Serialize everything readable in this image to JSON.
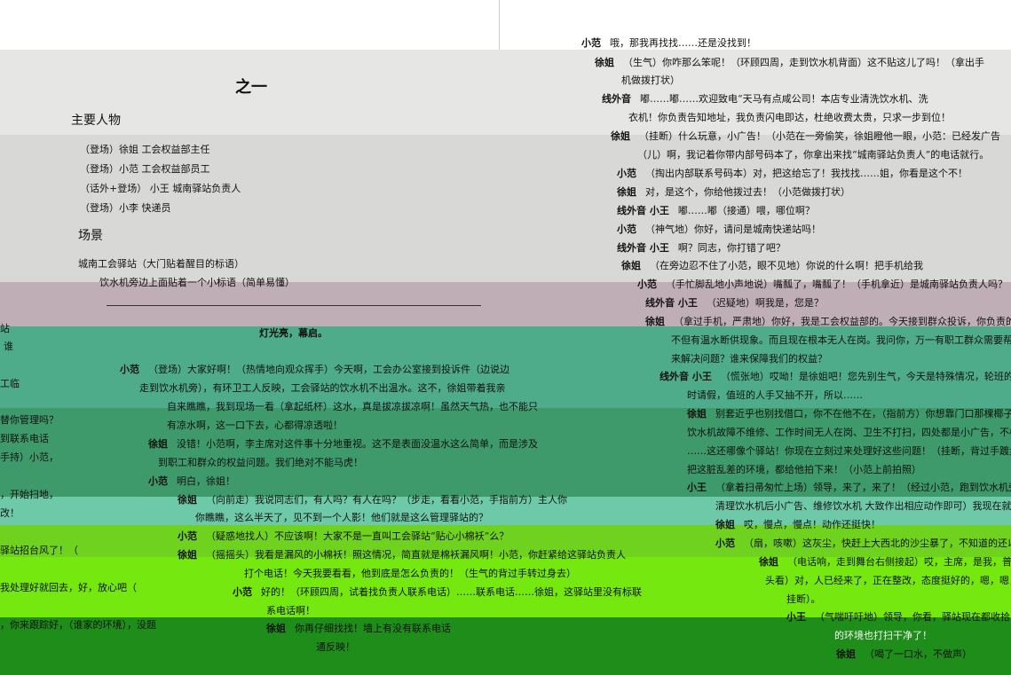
{
  "left": {
    "title": "之一",
    "characters_heading": "主要人物",
    "characters": [
      "（登场）徐姐 工会权益部主任",
      "（登场）小范 工会权益部员工",
      "（话外+登场） 小王 城南驿站负责人",
      "（登场）小李 快递员"
    ],
    "scene_heading": "场景",
    "scene_lines": [
      "城南工会驿站（大门贴着醒目的标语）",
      "饮水机旁边上面贴着一个小标语（简单易懂）"
    ],
    "stage_curtain": "灯光亮，幕启。",
    "dialogue": [
      {
        "speaker": "小范",
        "text": "（登场）大家好啊！（热情地向观众挥手）今天啊，工会办公室接到投诉件（边说边"
      },
      {
        "speaker": "",
        "text": "走到饮水机旁），有环卫工人反映，工会驿站的饮水机不出温水。这不，徐姐带着我亲"
      },
      {
        "speaker": "",
        "text": "自来瞧瞧，我到现场一看（拿起纸杯）这水，真是拔凉拔凉啊！虽然天气热，也不能只"
      },
      {
        "speaker": "",
        "text": "有凉水啊，这一口下去，心都得凉透啦！"
      },
      {
        "speaker": "徐姐",
        "text": "没错！小范啊，李主席对这件事十分地重视。这不是表面没温水这么简单，而是涉及"
      },
      {
        "speaker": "",
        "text": "到职工和群众的权益问题。我们绝对不能马虎！"
      },
      {
        "speaker": "小范",
        "text": "明白，徐姐！"
      },
      {
        "speaker": "徐姐",
        "text": "（向前走）我说同志们，有人吗？有人在吗？（步走，看看小范，手指前方）主人你"
      },
      {
        "speaker": "",
        "text": "你瞧瞧，这么半天了，见不到一个人影！他们就是这么管理驿站的？"
      },
      {
        "speaker": "小范",
        "text": "（疑惑地找人）不应该啊！大家不是一直叫工会驿站“贴心小棉袄”么？"
      },
      {
        "speaker": "徐姐",
        "text": "（摇摇头）我看是漏风的小棉袄！照这情况，简直就是棉袄漏风啊！小范，你赶紧给这驿站负责人"
      },
      {
        "speaker": "",
        "text": "打个电话！今天我要看看，他到底是怎么负责的！（生气的背过手转过身去）"
      },
      {
        "speaker": "小范",
        "text": "好的！（环顾四周，试着找负责人联系电话）……联系电话……徐姐，这驿站里没有标联"
      },
      {
        "speaker": "",
        "text": "系电话啊！"
      },
      {
        "speaker": "徐姐",
        "text": "你再仔细找找！墙上有没有联系电话"
      },
      {
        "speaker": "",
        "text": "通反映！"
      }
    ],
    "edge_fragments": [
      "站",
      "谁",
      "工临",
      "替你管理吗？",
      "到联系电话",
      "手持）小范，",
      "，开始扫地，",
      "改！",
      "驿站招台风了！（",
      "我处理好就回去，好，放心吧（",
      "，你来跟踪好，（谁家的环境），没题"
    ]
  },
  "right": {
    "dialogue": [
      {
        "speaker": "小范",
        "text": "哦，那我再找找……还是没找到！"
      },
      {
        "speaker": "徐姐",
        "text": "（生气）你咋那么笨呢！（环顾四周，走到饮水机背面）这不贴这儿了吗！（拿出手"
      },
      {
        "speaker": "",
        "text": "机做拨打状）"
      },
      {
        "speaker": "线外音",
        "text": "嘟……嘟……欢迎致电“天马有点咸公司！本店专业清洗饮水机、洗"
      },
      {
        "speaker": "",
        "text": "衣机！你负责告知地址，我负责闪电即达，杜绝收费太贵，只求一步到位！"
      },
      {
        "speaker": "徐姐",
        "text": "（挂断）什么玩意，小广告！（小范在一旁偷笑，徐姐瞪他一眼，小范：已经发广告"
      },
      {
        "speaker": "",
        "text": "（儿）啊，我记着你带内部号码本了，你拿出来找“城南驿站负责人”的电话就行。"
      },
      {
        "speaker": "小范",
        "text": "（掏出内部联系号码本）对，把这给忘了！我找找……姐，你看是这个不！"
      },
      {
        "speaker": "徐姐",
        "text": "对，是这个，你给他拨过去！（小范做拨打状）"
      },
      {
        "speaker": "线外音 小王",
        "text": "嘟……嘟（接通）喂，哪位啊？"
      },
      {
        "speaker": "小范",
        "text": "（神气地）你好，请问是城南快递站吗！"
      },
      {
        "speaker": "线外音 小王",
        "text": "啊？同志，你打错了吧？"
      },
      {
        "speaker": "徐姐",
        "text": "（在旁边忍不住了小范，眼不见地）你说的什么啊！把手机给我"
      },
      {
        "speaker": "小范",
        "text": "（手忙脚乱地小声地说）嘴瓢了，嘴瓢了！（手机拿近）是城南驿站负责人吗？"
      },
      {
        "speaker": "线外音 小王",
        "text": "（迟疑地）啊我是，您是？"
      },
      {
        "speaker": "徐姐",
        "text": "（拿过手机，严肃地）你好，我是工会权益部的。今天接到群众投诉，你负责的驿"
      },
      {
        "speaker": "",
        "text": "不但有温水断供现象。而且现在根本无人在岗。我问你，万一有职工群众需要帮助"
      },
      {
        "speaker": "",
        "text": "来解决问题？谁来保障我们的权益？"
      },
      {
        "speaker": "线外音 小王",
        "text": "（慌张地）哎呦！是徐姐吧！您先别生气，今天是特殊情况，轮班的员"
      },
      {
        "speaker": "",
        "text": "时请假，值班的人手又抽不开，所以……"
      },
      {
        "speaker": "徐姐",
        "text": "别套近乎也别找借口，你不在他不在，（指前方）你想靠门口那棵椰子树"
      },
      {
        "speaker": "",
        "text": "饮水机故障不维修、工作时间无人在岗、卫生不打扫，四处都是小广告，不标"
      },
      {
        "speaker": "",
        "text": "……这还哪像个驿站！你现在立刻过来处理好这些问题！（挂断，背过手踱步"
      },
      {
        "speaker": "",
        "text": "把这脏乱差的环境，都给他拍下来！（小范上前拍照）"
      },
      {
        "speaker": "小王",
        "text": "（拿着扫帚匆忙上场）领导，来了，来了！（经过小范，跑到饮水机旁"
      },
      {
        "speaker": "",
        "text": "清理饮水机后小广告、维修饮水机 大致作出相应动作即可）我现在就整"
      },
      {
        "speaker": "徐姐",
        "text": "哎，慢点，慢点！动作还挺快！"
      },
      {
        "speaker": "小范",
        "text": "（扇，咳嗽）这灰尘，快赶上大西北的沙尘暴了，不知道的还以为"
      },
      {
        "speaker": "徐姐",
        "text": "（电话响，走到舞台右侧接起）哎，主席，是我，普法"
      },
      {
        "speaker": "",
        "text": "头看）对，人已经来了，正在整改，态度挺好的，嗯，嗯，"
      },
      {
        "speaker": "",
        "text": "挂断）。"
      },
      {
        "speaker": "小王",
        "text": "（气喘吁吁地）领导，你看，驿站现在都收拾"
      },
      {
        "speaker": "",
        "text": "的环境也打扫干净了！"
      },
      {
        "speaker": "徐姐",
        "text": "（喝了一口水，不做声）"
      }
    ]
  }
}
